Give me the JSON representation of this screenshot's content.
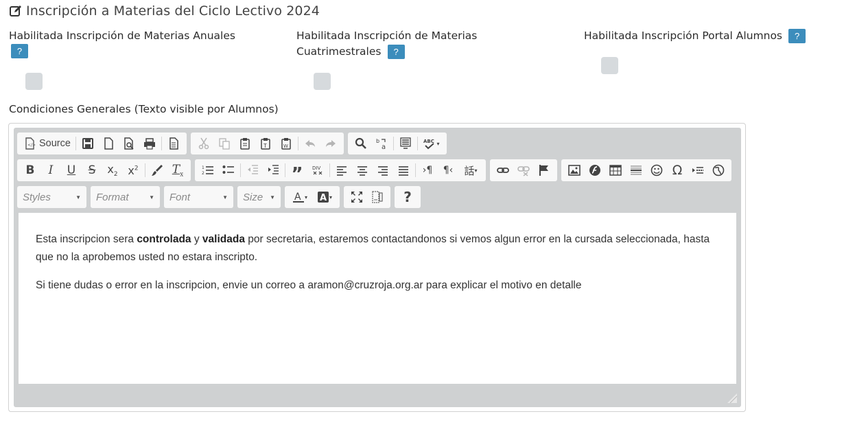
{
  "page": {
    "title": "Inscripción a Materias del Ciclo Lectivo 2024",
    "title_icon": "edit-icon"
  },
  "flags": {
    "anuales_label": "Habilitada Inscripción de Materias Anuales",
    "cuatrimestrales_label": "Habilitada Inscripción de Materias Cuatrimestrales",
    "portal_label": "Habilitada Inscripción Portal Alumnos",
    "help_text": "?"
  },
  "conditions": {
    "label": "Condiciones Generales (Texto visible por Alumnos)"
  },
  "editor": {
    "toolbar": {
      "source_label": "Source",
      "styles_label": "Styles",
      "format_label": "Format",
      "font_label": "Font",
      "size_label": "Size",
      "help_label": "?"
    },
    "content": {
      "p1_a": "Esta inscripcion sera ",
      "p1_b": "controlada",
      "p1_c": " y ",
      "p1_d": "validada",
      "p1_e": " por secretaria, estaremos contactandonos si vemos algun error en la cursada seleccionada, hasta que no la aprobemos usted no estara inscripto.",
      "p2": "Si tiene dudas o error en la inscripcion, envie un correo a aramon@cruzroja.org.ar para explicar el motivo en detalle"
    }
  },
  "colors": {
    "accent": "#3c8dbc",
    "toggle_off": "#d6dadd",
    "editor_chrome": "#cfd1d2"
  }
}
